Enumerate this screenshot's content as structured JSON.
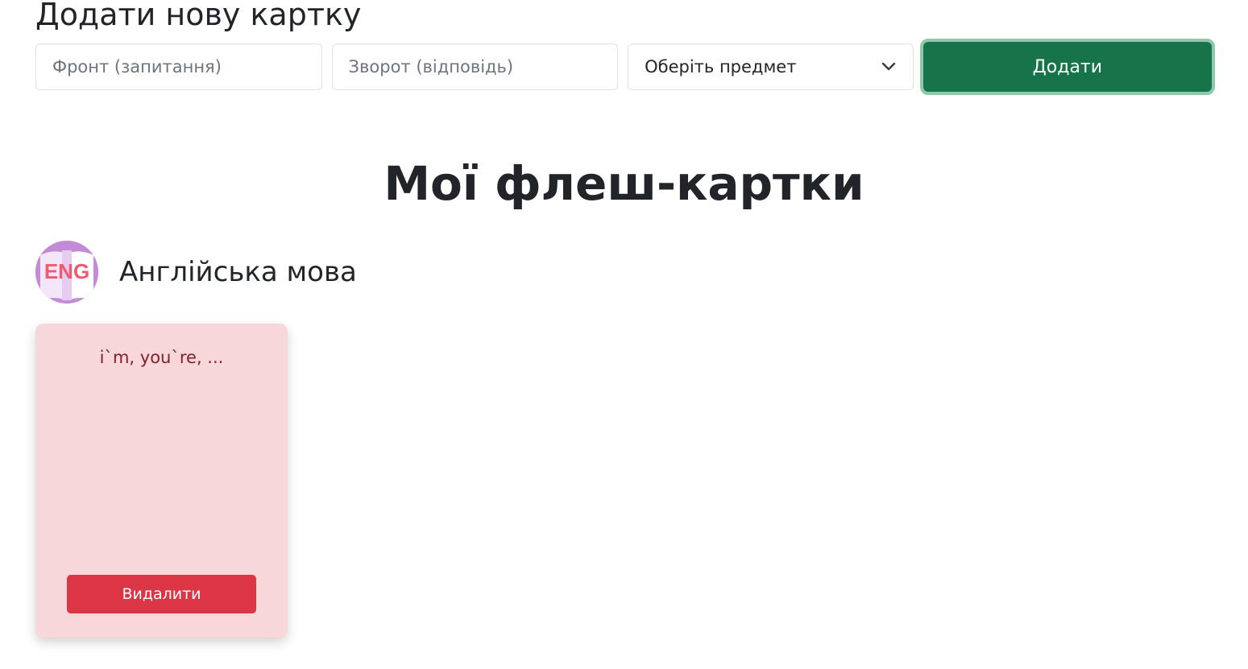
{
  "form": {
    "title": "Додати нову картку",
    "front_placeholder": "Фронт (запитання)",
    "back_placeholder": "Зворот (відповідь)",
    "subject_select": "Оберіть предмет",
    "add_label": "Додати"
  },
  "main": {
    "title": "Мої флеш-картки"
  },
  "subjects": [
    {
      "icon_text": "ENG",
      "name": "Англійська мова",
      "cards": [
        {
          "front": "i`m, you`re, ...",
          "delete_label": "Видалити"
        }
      ]
    }
  ],
  "colors": {
    "primary_green": "#17734a",
    "danger_red": "#dc3545",
    "card_bg": "#f8d7da",
    "card_text": "#842029",
    "icon_purple": "#c48ad7",
    "icon_text": "#f05a6e"
  },
  "icons": {
    "select_chevron": "chevron-down-icon",
    "subject_icon": "eng-book-icon"
  }
}
